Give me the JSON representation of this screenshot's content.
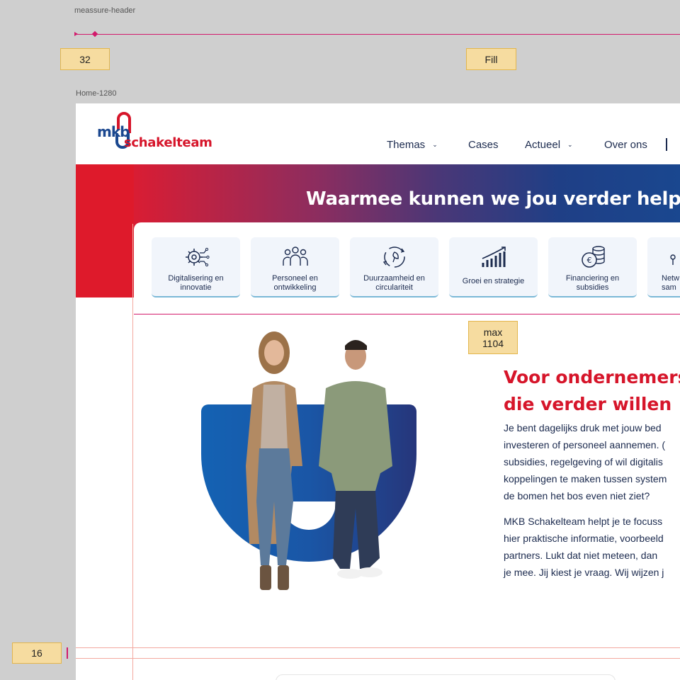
{
  "annotations": {
    "header_label": "meassure-header",
    "frame_label": "Home-1280",
    "tag_padding": "32",
    "tag_fill": "Fill",
    "tag_max_line1": "max",
    "tag_max_line2": "1104",
    "tag_gap": "16",
    "accent_color": "#d21a6b"
  },
  "logo": {
    "mkb": "mkb",
    "schakelteam": "schakelteam"
  },
  "nav": {
    "items": [
      {
        "label": "Themas",
        "dropdown": true
      },
      {
        "label": "Cases",
        "dropdown": false
      },
      {
        "label": "Actueel",
        "dropdown": true
      },
      {
        "label": "Over ons",
        "dropdown": false
      }
    ]
  },
  "hero": {
    "title": "Waarmee kunnen we jou verder helpen?"
  },
  "themes": [
    {
      "label_line1": "Digitalisering en",
      "label_line2": "innovatie",
      "icon": "gear-circuit-icon"
    },
    {
      "label_line1": "Personeel en",
      "label_line2": "ontwikkeling",
      "icon": "people-group-icon"
    },
    {
      "label_line1": "Duurzaamheid en",
      "label_line2": "circulariteit",
      "icon": "recycle-icon"
    },
    {
      "label_line1": "Groei en strategie",
      "label_line2": "",
      "icon": "growth-chart-icon"
    },
    {
      "label_line1": "Financiering en",
      "label_line2": "subsidies",
      "icon": "euro-coins-icon"
    },
    {
      "label_line1": "Netw",
      "label_line2": "sam",
      "icon": "network-icon"
    }
  ],
  "intro": {
    "title_line1": "Voor ondernemers",
    "title_line2": "die verder willen",
    "para1": [
      "Je bent dagelijks druk met jouw bed",
      "investeren of personeel aannemen. (",
      "subsidies, regelgeving of wil digitalis",
      "koppelingen te maken tussen system",
      "de bomen het bos even niet ziet?"
    ],
    "para2": [
      "MKB Schakelteam helpt je te focuss",
      "hier praktische informatie, voorbeeld",
      "partners. Lukt dat niet meteen, dan",
      "je mee. Jij kiest je vraag. Wij wijzen j"
    ]
  },
  "colors": {
    "brand_red": "#d6152a",
    "brand_navy": "#1b2a4e",
    "brand_blue": "#1a478f"
  }
}
